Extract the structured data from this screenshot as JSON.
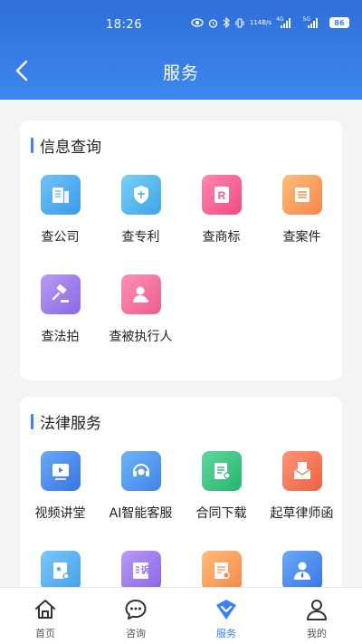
{
  "status": {
    "time": "18:26",
    "net_speed_top": "114",
    "net_speed_bottom": "B/s",
    "signal1": "4G",
    "signal2": "5G",
    "battery": "86"
  },
  "header": {
    "title": "服务"
  },
  "sections": [
    {
      "title": "信息查询",
      "items": [
        {
          "label": "查公司",
          "icon": "company-icon"
        },
        {
          "label": "查专利",
          "icon": "patent-shield-icon"
        },
        {
          "label": "查商标",
          "icon": "trademark-r-icon"
        },
        {
          "label": "查案件",
          "icon": "case-file-icon"
        },
        {
          "label": "查法拍",
          "icon": "auction-gavel-icon"
        },
        {
          "label": "查被执行人",
          "icon": "person-icon"
        }
      ]
    },
    {
      "title": "法律服务",
      "items": [
        {
          "label": "视频讲堂",
          "icon": "video-icon"
        },
        {
          "label": "AI智能客服",
          "icon": "headset-icon"
        },
        {
          "label": "合同下载",
          "icon": "contract-icon"
        },
        {
          "label": "起草律师函",
          "icon": "letter-envelope-icon"
        },
        {
          "label": "",
          "icon": "certificate-icon"
        },
        {
          "label": "诉",
          "icon": "lawsuit-icon"
        },
        {
          "label": "",
          "icon": "document-seal-icon"
        },
        {
          "label": "",
          "icon": "lawyer-icon"
        }
      ]
    }
  ],
  "nav": [
    {
      "label": "首页",
      "icon": "home-icon",
      "active": false
    },
    {
      "label": "咨询",
      "icon": "chat-icon",
      "active": false
    },
    {
      "label": "服务",
      "icon": "service-icon",
      "active": true
    },
    {
      "label": "我的",
      "icon": "profile-icon",
      "active": false
    }
  ],
  "colors": {
    "header": "#3d86f0",
    "accent": "#3b82f6"
  }
}
